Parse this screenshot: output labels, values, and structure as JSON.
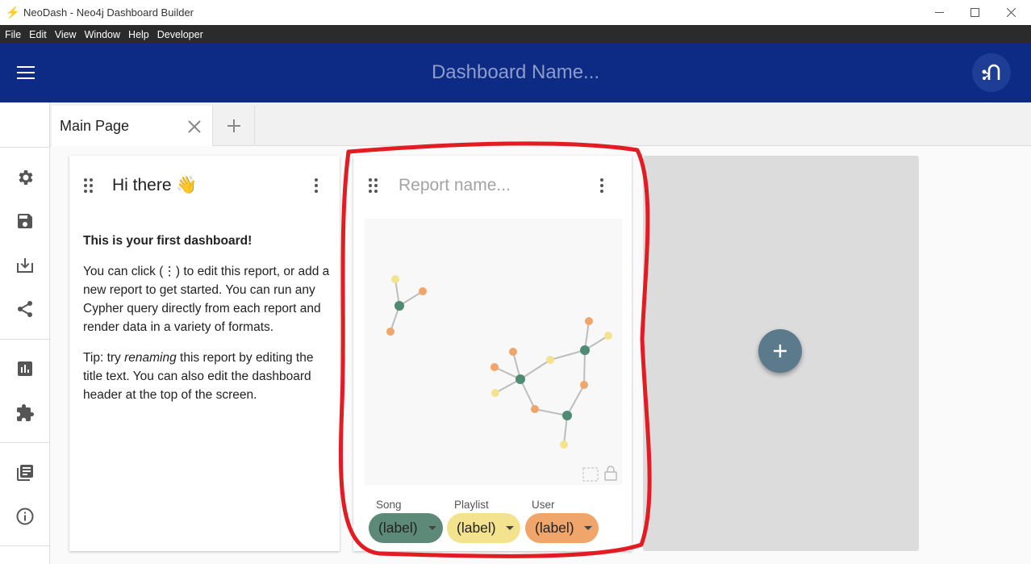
{
  "window": {
    "title": "NeoDash - Neo4j Dashboard Builder",
    "controls": [
      "minimize-icon",
      "maximize-icon",
      "close-icon"
    ]
  },
  "menubar": {
    "items": [
      "File",
      "Edit",
      "View",
      "Window",
      "Help",
      "Developer"
    ]
  },
  "appbar": {
    "dashboard_name_placeholder": "Dashboard Name...",
    "color": "#0d2a85"
  },
  "sidebar": {
    "icons": [
      "settings-icon",
      "save-icon",
      "load-icon",
      "share-icon",
      "examples-icon",
      "extensions-icon",
      "documentation-icon",
      "about-icon"
    ]
  },
  "tabs": {
    "pages": [
      {
        "label": "Main Page"
      }
    ],
    "add_icon": "plus-icon"
  },
  "cards": {
    "welcome": {
      "title": "Hi there 👋",
      "heading": "This is your first dashboard!",
      "paragraph1": "You can click (⋮) to edit this report, or add a new report to get started. You can run any Cypher query directly from each report and render data in a variety of formats.",
      "tip_prefix": "Tip: try ",
      "tip_emphasis": "renaming",
      "tip_suffix": " this report by editing the title text. You can also edit the dashboard header at the top of the screen."
    },
    "graph": {
      "title_placeholder": "Report name...",
      "legend": [
        {
          "name": "Song",
          "chip": "(label)",
          "color": "#5d8a78"
        },
        {
          "name": "Playlist",
          "chip": "(label)",
          "color": "#f3e28e"
        },
        {
          "name": "User",
          "chip": "(label)",
          "color": "#f0a56a"
        }
      ]
    }
  },
  "add_report": {
    "icon": "plus-icon",
    "color": "#5b7a8c"
  }
}
